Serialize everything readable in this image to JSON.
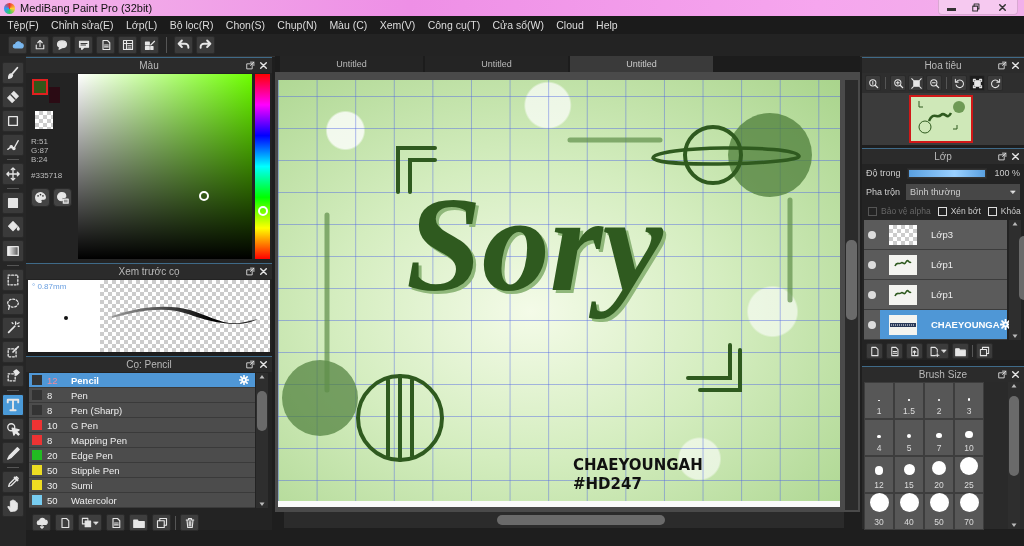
{
  "window": {
    "title": "MediBang Paint Pro (32bit)"
  },
  "menu": [
    "Tệp(F)",
    "Chỉnh sửa(E)",
    "Lớp(L)",
    "Bộ lọc(R)",
    "Chọn(S)",
    "Chụp(N)",
    "Màu (C)",
    "Xem(V)",
    "Công cụ(T)",
    "Cửa sổ(W)",
    "Cloud",
    "Help"
  ],
  "tools": [
    {
      "selected": false
    },
    {
      "selected": false
    },
    {
      "selected": false
    },
    {
      "selected": false
    },
    {
      "selected": false
    },
    {
      "selected": false
    },
    {
      "selected": false
    },
    {
      "selected": false
    },
    {
      "selected": false
    },
    {
      "selected": false
    },
    {
      "selected": false
    },
    {
      "selected": false
    },
    {
      "selected": false
    },
    {
      "selected": true
    },
    {
      "selected": false
    },
    {
      "selected": false
    },
    {
      "selected": false
    },
    {
      "selected": false
    }
  ],
  "color_panel": {
    "title": "Màu",
    "swatches": [
      {
        "kind": "foreground",
        "color": "#335718"
      },
      {
        "kind": "background",
        "color": "#2b0b14"
      }
    ],
    "readouts": [
      "R:51",
      "G:87",
      "B:24"
    ],
    "hex": "#335718"
  },
  "brush_preview": {
    "title": "Xem trước cọ",
    "size": "° 0.87mm"
  },
  "brush_panel": {
    "title": "Cọ: Pencil",
    "brushes": [
      {
        "size": "12",
        "name": "Pencil",
        "color": "#333333",
        "selected": true
      },
      {
        "size": "8",
        "name": "Pen",
        "color": "#333333",
        "selected": false
      },
      {
        "size": "8",
        "name": "Pen (Sharp)",
        "color": "#333333",
        "selected": false
      },
      {
        "size": "10",
        "name": "G Pen",
        "color": "#ee3333",
        "selected": false
      },
      {
        "size": "8",
        "name": "Mapping Pen",
        "color": "#ee3333",
        "selected": false
      },
      {
        "size": "20",
        "name": "Edge Pen",
        "color": "#22bb22",
        "selected": false
      },
      {
        "size": "50",
        "name": "Stipple Pen",
        "color": "#eedd22",
        "selected": false
      },
      {
        "size": "30",
        "name": "Sumi",
        "color": "#eedd22",
        "selected": false
      },
      {
        "size": "50",
        "name": "Watercolor",
        "color": "#77ccf0",
        "selected": false
      }
    ]
  },
  "document_tabs": [
    {
      "label": "Untitled",
      "selected": false
    },
    {
      "label": "Untitled",
      "selected": false
    },
    {
      "label": "Untitled",
      "selected": true
    }
  ],
  "artwork": {
    "title_text": "Sory",
    "signature": "CHAEYOUNGAH",
    "tag": "#HD247"
  },
  "navigator": {
    "title": "Hoa tiêu"
  },
  "layer_panel": {
    "title": "Lớp",
    "opacity_label": "Độ trong",
    "opacity": {
      "level": 1
    },
    "opacity_value": "100 %",
    "blend_label": "Pha trộn",
    "blend_mode": "Bình thường",
    "options": [
      {
        "label": "Bảo vệ alpha",
        "checked": false,
        "disabled": true
      },
      {
        "label": "Xén bớt",
        "checked": false,
        "disabled": false
      },
      {
        "label": "Khóa",
        "checked": false,
        "disabled": false
      }
    ],
    "layers": [
      {
        "name": "Lớp3",
        "visible": true,
        "selected": false,
        "kind": "blank"
      },
      {
        "name": "Lớp1",
        "visible": true,
        "selected": false,
        "kind": "artwork"
      },
      {
        "name": "Lớp1",
        "visible": true,
        "selected": false,
        "kind": "artwork"
      },
      {
        "name": "CHAEYOUNGA",
        "visible": true,
        "selected": true,
        "kind": "text"
      }
    ]
  },
  "brush_size_panel": {
    "title": "Brush Size",
    "sizes": [
      "1",
      "1.5",
      "2",
      "3",
      "4",
      "5",
      "7",
      "10",
      "12",
      "15",
      "20",
      "25",
      "30",
      "40",
      "50",
      "70"
    ]
  }
}
